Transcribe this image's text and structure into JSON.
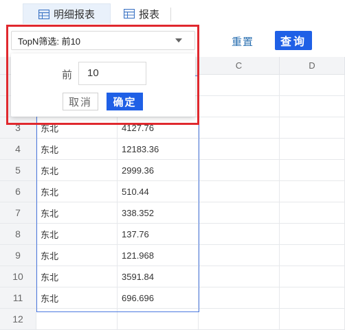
{
  "tabs": [
    {
      "label": "明细报表",
      "icon": "report-table-icon",
      "active": true
    },
    {
      "label": "报表",
      "icon": "report-table-icon",
      "active": false
    }
  ],
  "toolbar": {
    "topn_select_value": "TopN筛选: 前10",
    "reset_label": "重置",
    "query_label": "查询"
  },
  "popup": {
    "prefix_label": "前",
    "n_value": "10",
    "cancel_label": "取消",
    "ok_label": "确定"
  },
  "grid": {
    "columns": [
      "C",
      "D"
    ],
    "rows": [
      {
        "num": "3",
        "a": "东北",
        "b": "4127.76"
      },
      {
        "num": "4",
        "a": "东北",
        "b": "12183.36"
      },
      {
        "num": "5",
        "a": "东北",
        "b": "2999.36"
      },
      {
        "num": "6",
        "a": "东北",
        "b": "510.44"
      },
      {
        "num": "7",
        "a": "东北",
        "b": "338.352"
      },
      {
        "num": "8",
        "a": "东北",
        "b": "137.76"
      },
      {
        "num": "9",
        "a": "东北",
        "b": "121.968"
      },
      {
        "num": "10",
        "a": "东北",
        "b": "3591.84"
      },
      {
        "num": "11",
        "a": "东北",
        "b": "696.696"
      },
      {
        "num": "12",
        "a": "",
        "b": ""
      }
    ]
  },
  "colors": {
    "accent": "#1f60e6",
    "highlight": "#e0282e",
    "selection": "#4a78e0",
    "link": "#2a6fb0"
  }
}
